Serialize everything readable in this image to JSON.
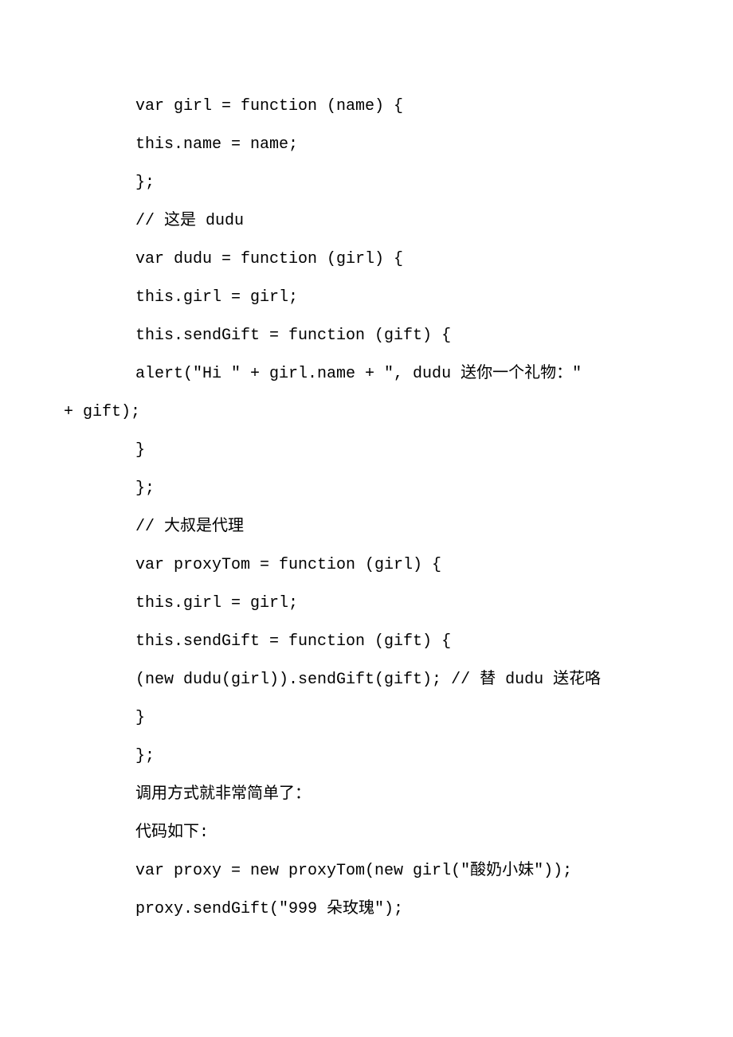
{
  "lines": [
    {
      "indent": true,
      "text": "var girl = function (name) {"
    },
    {
      "indent": true,
      "text": "this.name = name;"
    },
    {
      "indent": true,
      "text": "};"
    },
    {
      "indent": true,
      "text": "// 这是 dudu"
    },
    {
      "indent": true,
      "text": "var dudu = function (girl) {"
    },
    {
      "indent": true,
      "text": "this.girl = girl;"
    },
    {
      "indent": true,
      "text": "this.sendGift = function (gift) {"
    },
    {
      "indent": true,
      "text": "alert(\"Hi \" + girl.name + \", dudu 送你一个礼物：\""
    },
    {
      "indent": false,
      "text": "+ gift);"
    },
    {
      "indent": true,
      "text": "}"
    },
    {
      "indent": true,
      "text": "};"
    },
    {
      "indent": true,
      "text": "// 大叔是代理"
    },
    {
      "indent": true,
      "text": "var proxyTom = function (girl) {"
    },
    {
      "indent": true,
      "text": "this.girl = girl;"
    },
    {
      "indent": true,
      "text": "this.sendGift = function (gift) {"
    },
    {
      "indent": true,
      "text": "(new dudu(girl)).sendGift(gift); // 替 dudu 送花咯"
    },
    {
      "indent": true,
      "text": "}"
    },
    {
      "indent": true,
      "text": "};"
    },
    {
      "indent": true,
      "text": "调用方式就非常简单了："
    },
    {
      "indent": true,
      "text": "代码如下:"
    },
    {
      "indent": true,
      "text": "var proxy = new proxyTom(new girl(\"酸奶小妹\"));"
    },
    {
      "indent": true,
      "text": "proxy.sendGift(\"999 朵玫瑰\");"
    }
  ]
}
